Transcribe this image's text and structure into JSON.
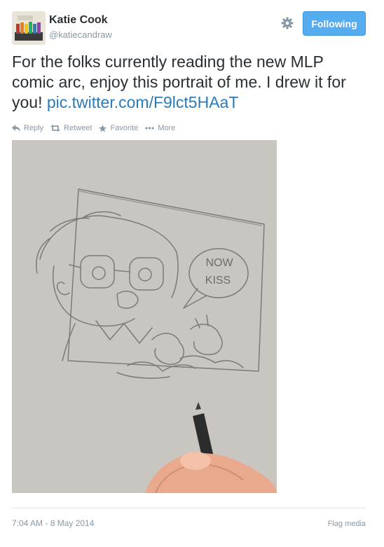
{
  "user": {
    "name": "Katie Cook",
    "handle": "@katiecandraw"
  },
  "header": {
    "gear_icon": "gear-icon",
    "follow_button_label": "Following",
    "follow_button_color": "#55acee"
  },
  "tweet": {
    "text": "For the folks currently reading the new MLP comic arc, enjoy this portrait of me. I drew it for you!",
    "link": "pic.twitter.com/F9lct5HAaT",
    "link_color": "#2b7bb9"
  },
  "actions": [
    {
      "label": "Reply",
      "icon": "reply-icon"
    },
    {
      "label": "Retweet",
      "icon": "retweet-icon"
    },
    {
      "label": "Favorite",
      "icon": "star-icon"
    },
    {
      "label": "More",
      "icon": "more-icon"
    }
  ],
  "photo": {
    "speech_bubble_text": [
      "NOW",
      "KISS"
    ]
  },
  "footer": {
    "timestamp": "7:04 AM - 8 May 2014",
    "flag_label": "Flag media"
  }
}
